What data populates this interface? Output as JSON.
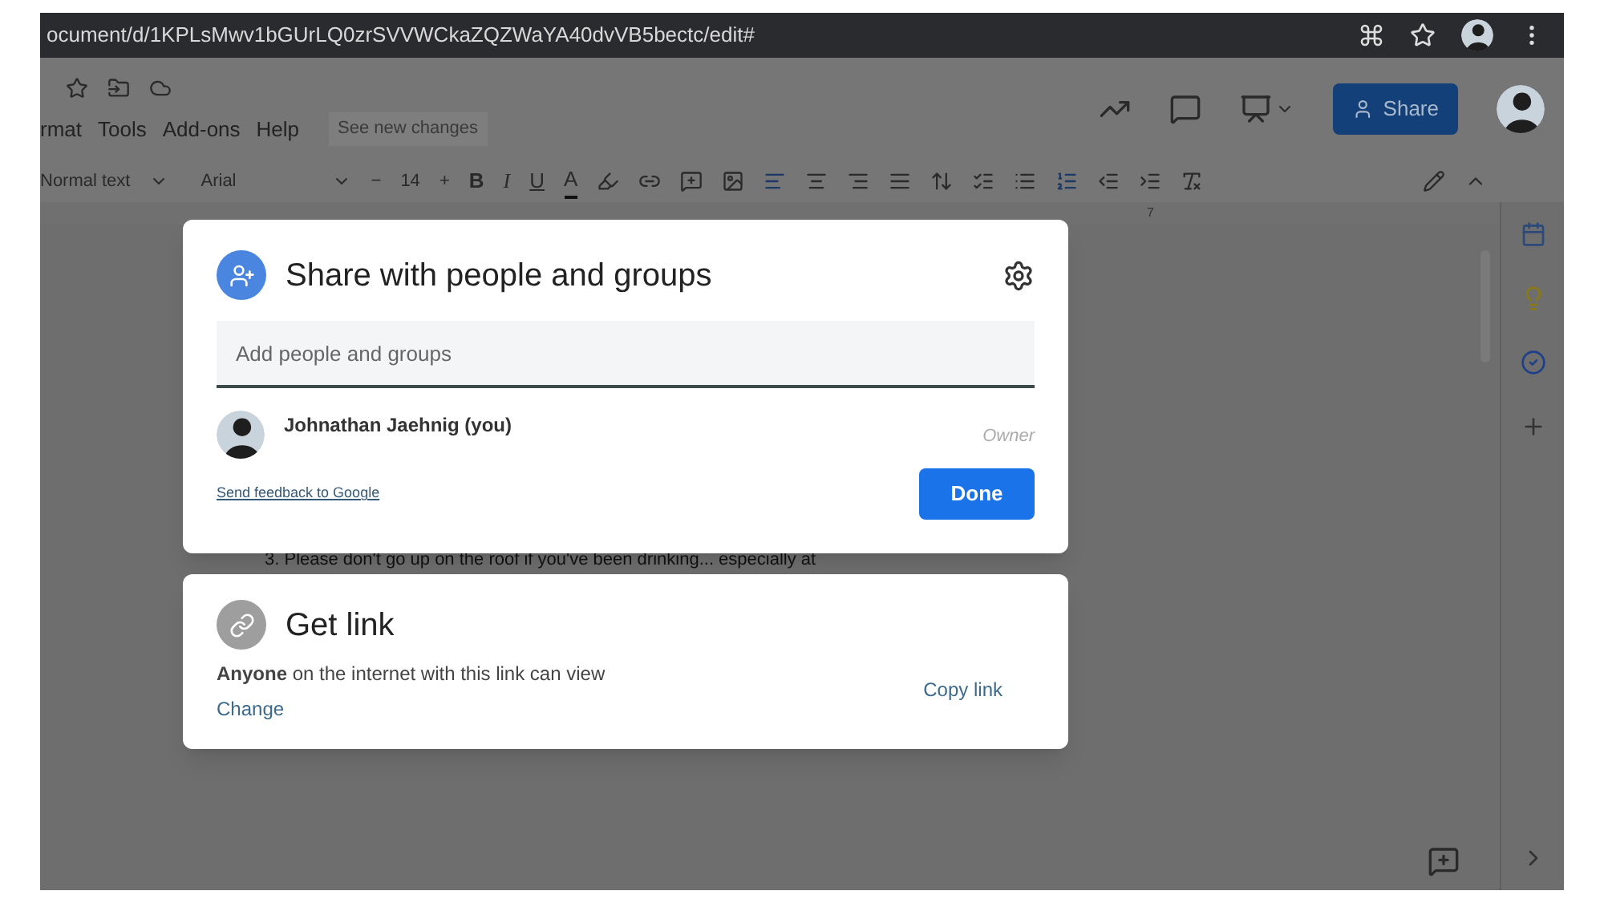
{
  "browser": {
    "url": "ocument/d/1KPLsMwv1bGUrLQ0zrSVVWCkaZQZWaYA40dvVB5bectc/edit#"
  },
  "menu": [
    "rmat",
    "Tools",
    "Add-ons",
    "Help"
  ],
  "see_new_changes": "See new changes",
  "share_button": "Share",
  "toolbar": {
    "style": "Normal text",
    "font": "Arial",
    "size": "14",
    "minus": "−",
    "plus": "+",
    "format_letters": [
      "B",
      "I",
      "U",
      "A"
    ]
  },
  "ruler": [
    "7"
  ],
  "document": {
    "line": "3. Please don't go up on the roof if you've been drinking... especially at"
  },
  "share_dialog": {
    "title": "Share with people and groups",
    "input_placeholder": "Add people and groups",
    "people": [
      {
        "name": "Johnathan Jaehnig (you)",
        "role": "Owner"
      }
    ],
    "feedback_link": "Send feedback to Google",
    "done": "Done"
  },
  "link_dialog": {
    "title": "Get link",
    "description": "**Anyone** on the internet with this link can view",
    "change": "Change",
    "copy": "Copy link"
  }
}
